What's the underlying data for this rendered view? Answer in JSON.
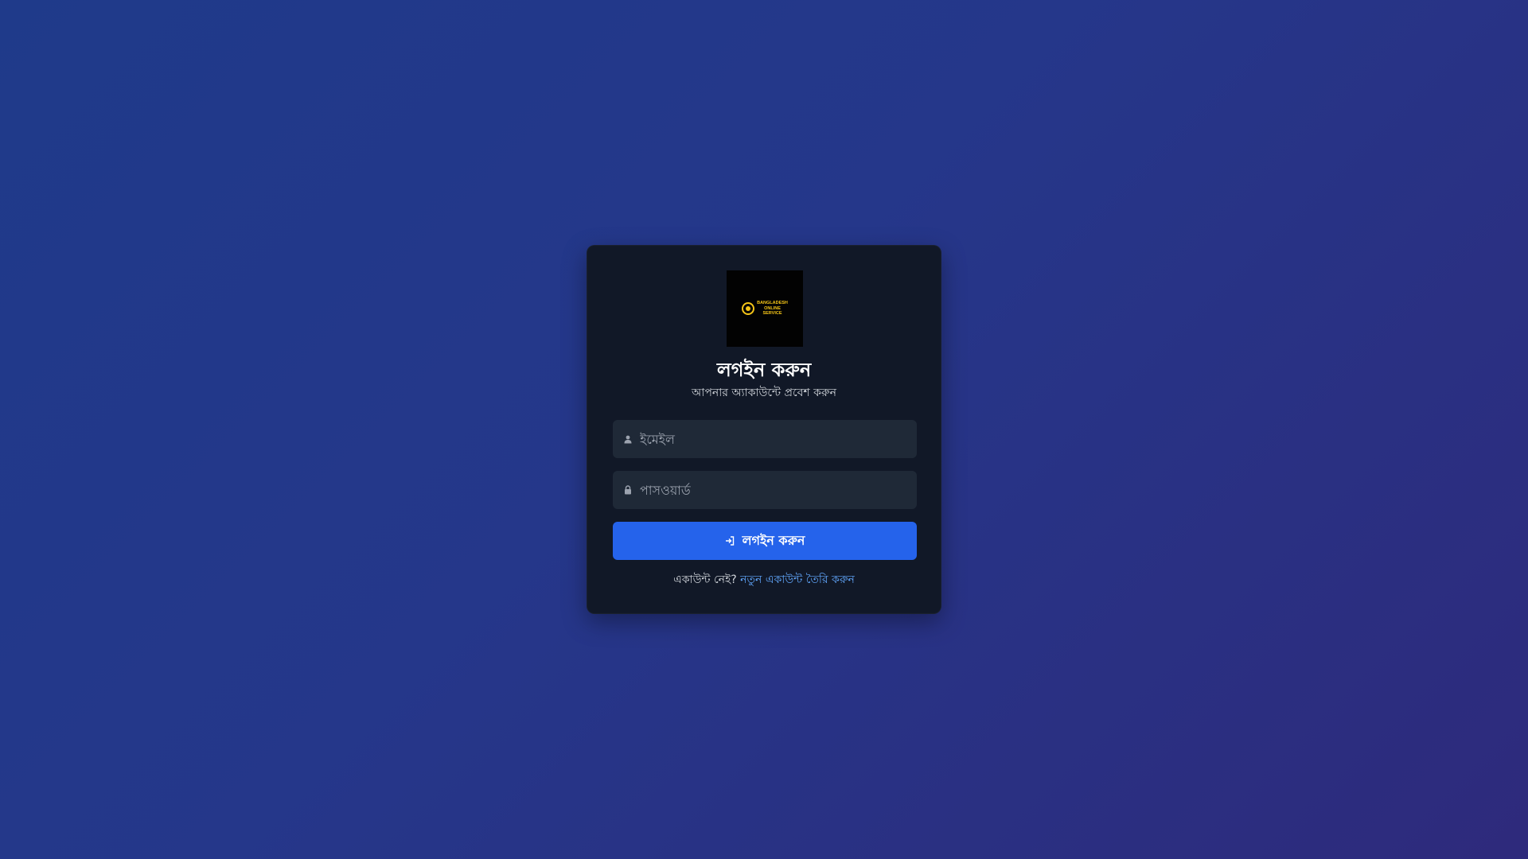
{
  "logo": {
    "text_line1": "BANGLADESH",
    "text_line2": "ONLINE",
    "text_line3": "SERVICE",
    "accent_color": "#f5c518"
  },
  "login": {
    "title": "লগইন করুন",
    "subtitle": "আপনার অ্যাকাউন্টে প্রবেশ করুন",
    "email_placeholder": "ইমেইল",
    "email_icon": "user-icon",
    "password_placeholder": "পাসওয়ার্ড",
    "password_icon": "lock-icon",
    "button_label": "লগইন করুন",
    "button_icon": "sign-in-icon",
    "button_color": "#2563eb"
  },
  "footer": {
    "prompt_text": "একাউন্ট নেই?",
    "register_link": "নতুন একাউন্ট তৈরি করুন",
    "link_color": "#60a5fa"
  }
}
